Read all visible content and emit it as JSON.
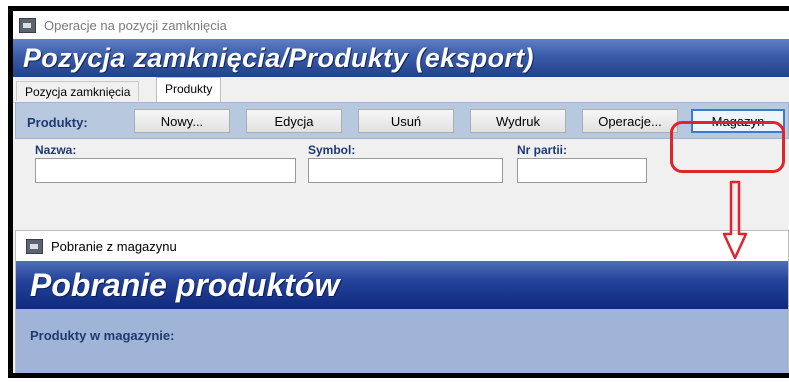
{
  "window": {
    "title": "Operacje na pozycji zamknięcia",
    "banner": "Pozycja zamknięcia/Produkty (eksport)"
  },
  "tabs": [
    {
      "label": "Pozycja zamknięcia",
      "active": false
    },
    {
      "label": "Produkty",
      "active": true
    }
  ],
  "toolbar": {
    "label": "Produkty:",
    "buttons": [
      {
        "label": "Nowy..."
      },
      {
        "label": "Edycja"
      },
      {
        "label": "Usuń"
      },
      {
        "label": "Wydruk"
      },
      {
        "label": "Operacje..."
      },
      {
        "label": "Magazyn"
      }
    ]
  },
  "filters": {
    "name_label": "Nazwa:",
    "name_value": "",
    "symbol_label": "Symbol:",
    "symbol_value": "",
    "batch_label": "Nr partii:",
    "batch_value": ""
  },
  "subwindow": {
    "title": "Pobranie z magazynu",
    "banner": "Pobranie produktów",
    "section_label": "Produkty w magazynie:"
  },
  "annotation": {
    "color": "#e0242c"
  },
  "colors": {
    "banner": "#3a5ca8",
    "toolbar": "#b8c8de",
    "label_text": "#1f3a72",
    "highlight": "#e0242c"
  }
}
